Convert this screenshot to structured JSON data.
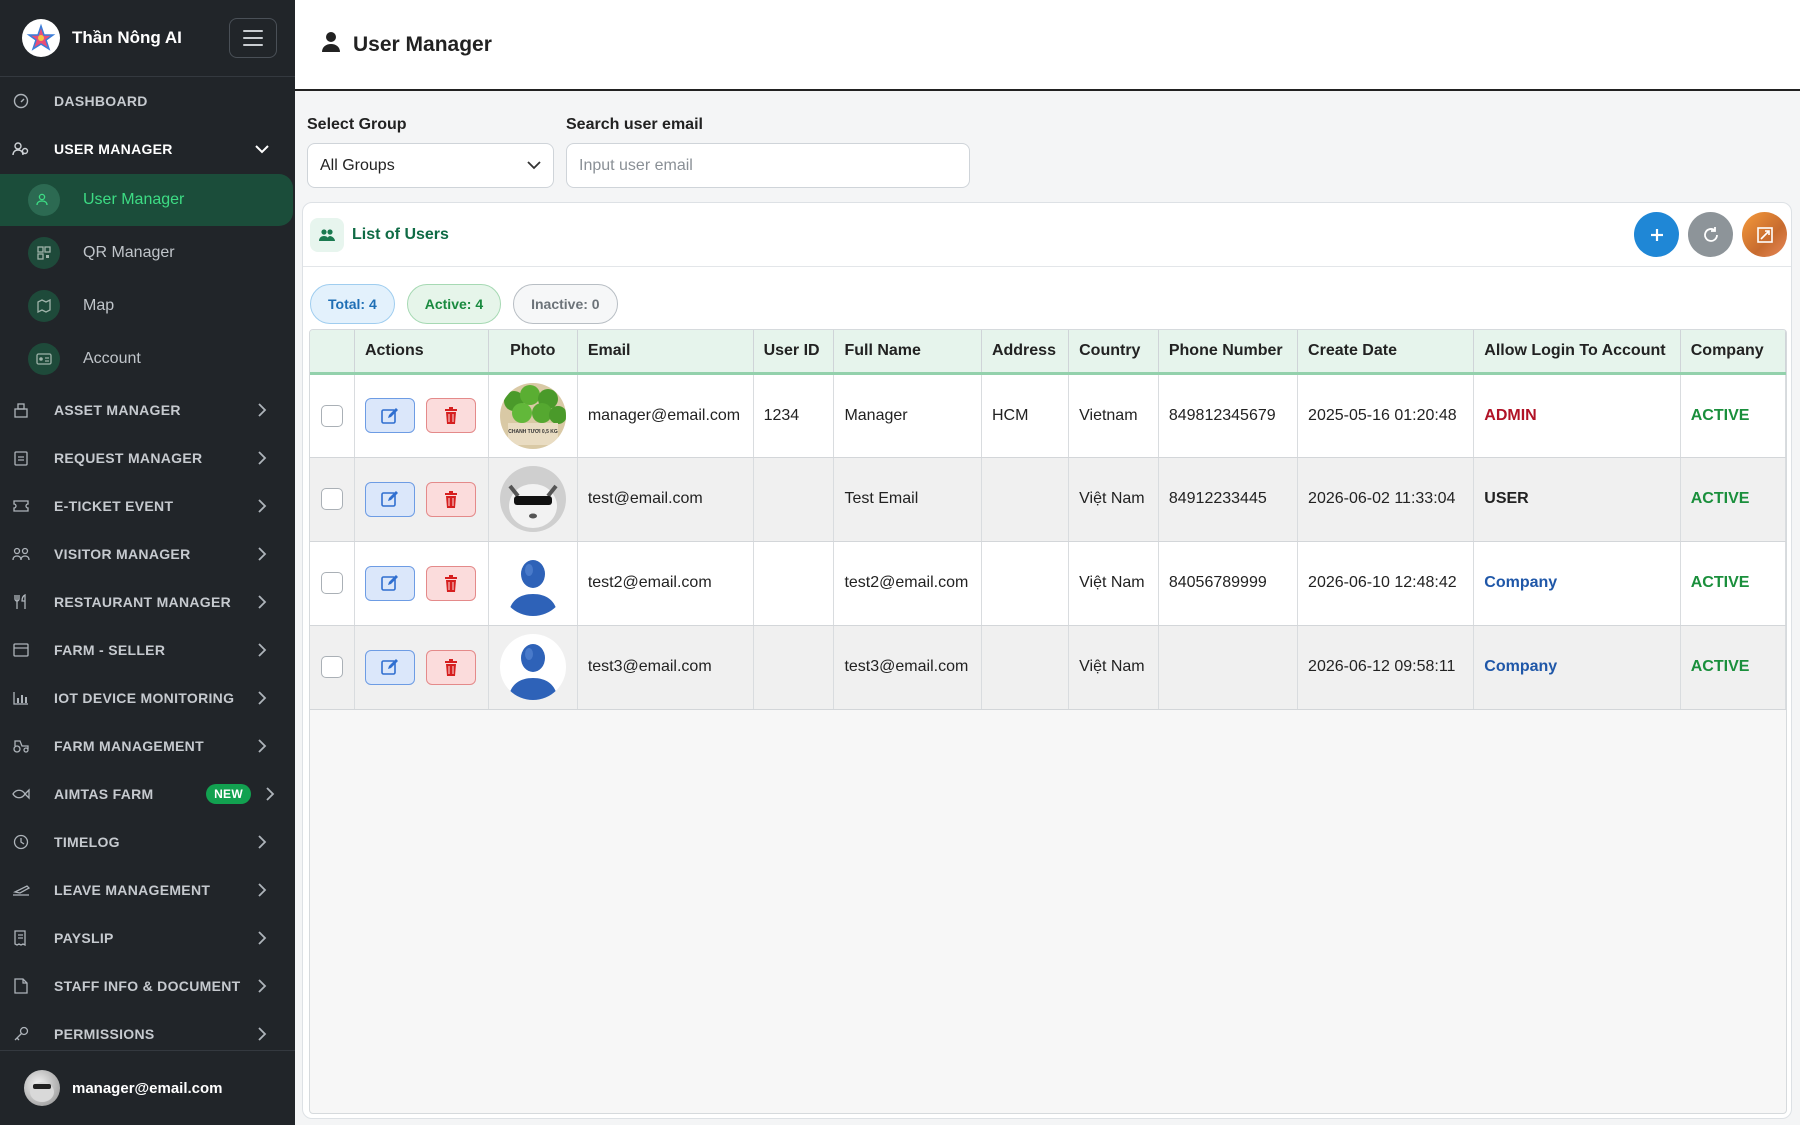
{
  "app": {
    "brand_name": "Thần Nông AI"
  },
  "sidebar": {
    "items": [
      {
        "label": "DASHBOARD",
        "icon": "gauge-icon"
      },
      {
        "label": "USER MANAGER",
        "icon": "users-gear-icon",
        "expanded": true
      },
      {
        "label": "ASSET MANAGER",
        "icon": "asset-icon"
      },
      {
        "label": "REQUEST MANAGER",
        "icon": "clipboard-icon"
      },
      {
        "label": "E-TICKET EVENT",
        "icon": "ticket-icon"
      },
      {
        "label": "VISITOR MANAGER",
        "icon": "visitors-icon"
      },
      {
        "label": "RESTAURANT MANAGER",
        "icon": "utensils-icon"
      },
      {
        "label": "FARM - SELLER",
        "icon": "store-icon"
      },
      {
        "label": "IOT DEVICE MONITORING",
        "icon": "chart-icon"
      },
      {
        "label": "FARM MANAGEMENT",
        "icon": "tractor-icon"
      },
      {
        "label": "AIMTAS FARM",
        "icon": "fish-icon",
        "badge": "NEW"
      },
      {
        "label": "TIMELOG",
        "icon": "clock-icon"
      },
      {
        "label": "LEAVE MANAGEMENT",
        "icon": "plane-icon"
      },
      {
        "label": "PAYSLIP",
        "icon": "receipt-icon"
      },
      {
        "label": "STAFF INFO & DOCUMENT",
        "icon": "document-icon"
      },
      {
        "label": "PERMISSIONS",
        "icon": "key-icon"
      }
    ],
    "sub_items": [
      {
        "label": "User Manager",
        "active": true,
        "icon": "users-gear-icon"
      },
      {
        "label": "QR Manager",
        "active": false,
        "icon": "qr-icon"
      },
      {
        "label": "Map",
        "active": false,
        "icon": "map-icon"
      },
      {
        "label": "Account",
        "active": false,
        "icon": "id-card-icon"
      }
    ],
    "footer_user": "manager@email.com"
  },
  "header": {
    "title": "User Manager",
    "icon": "user-icon"
  },
  "filters": {
    "group_label": "Select Group",
    "group_value": "All Groups",
    "search_label": "Search user email",
    "search_placeholder": "Input user email"
  },
  "card": {
    "title": "List of Users",
    "stats": {
      "total": "Total: 4",
      "active": "Active: 4",
      "inactive": "Inactive: 0"
    }
  },
  "table": {
    "columns": [
      "",
      "Actions",
      "Photo",
      "Email",
      "User ID",
      "Full Name",
      "Address",
      "Country",
      "Phone Number",
      "Create Date",
      "Allow Login To Account",
      "Company"
    ],
    "rows": [
      {
        "email": "manager@email.com",
        "user_id": "1234",
        "full_name": "Manager",
        "address": "HCM",
        "country": "Vietnam",
        "phone": "849812345679",
        "create_date": "2025-05-16 01:20:48",
        "role": "ADMIN",
        "status": "ACTIVE",
        "photo": "limes-basket",
        "photo_text": "CHANH TƯƠI 0,5 KG"
      },
      {
        "email": "test@email.com",
        "user_id": "",
        "full_name": "Test Email",
        "address": "",
        "country": "Việt Nam",
        "phone": "84912233445",
        "create_date": "2026-06-02 11:33:04",
        "role": "USER",
        "status": "ACTIVE",
        "photo": "cat-sunglasses"
      },
      {
        "email": "test2@email.com",
        "user_id": "",
        "full_name": "test2@email.com",
        "address": "",
        "country": "Việt Nam",
        "phone": "84056789999",
        "create_date": "2026-06-10 12:48:42",
        "role": "Company",
        "status": "ACTIVE",
        "photo": "default-avatar"
      },
      {
        "email": "test3@email.com",
        "user_id": "",
        "full_name": "test3@email.com",
        "address": "",
        "country": "Việt Nam",
        "phone": "",
        "create_date": "2026-06-12 09:58:11",
        "role": "Company",
        "status": "ACTIVE",
        "photo": "default-avatar"
      }
    ]
  },
  "colors": {
    "sidebar_bg": "#212529",
    "accent_green": "#3ddc84",
    "add_button": "#1f87d6",
    "admin_red": "#b11226",
    "company_blue": "#1f57a8",
    "active_green": "#1a8f3c"
  }
}
